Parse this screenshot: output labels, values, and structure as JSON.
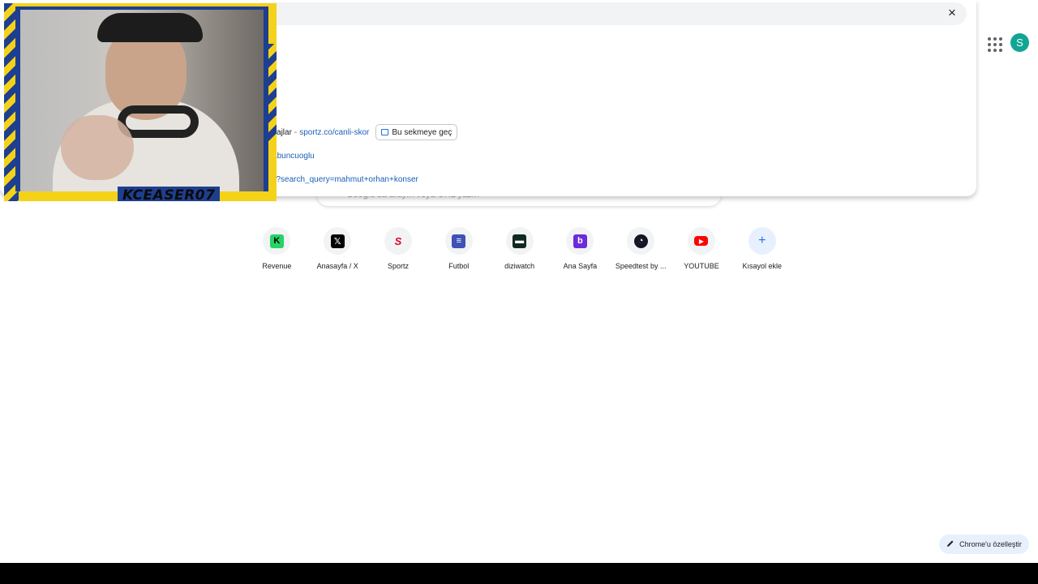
{
  "header": {
    "avatar_letter": "S",
    "apps_icon": "apps-grid-icon"
  },
  "omnibox": {
    "close_label": "×",
    "suggestions": [
      {
        "title": "...lı Mesajlar",
        "sep": "-",
        "url": "sportz.co/canli-skor",
        "action": "Bu sekmeye geç"
      },
      {
        "title": "",
        "sep": "",
        "url": "...agosabuncuoglu"
      },
      {
        "title": "",
        "sep": "",
        "url": "...esults?search_query=mahmut+orhan+konser"
      }
    ]
  },
  "search": {
    "placeholder": "Google'da arayın veya URL yazın"
  },
  "webcam": {
    "channel_label": "KCEASER07"
  },
  "shortcuts": [
    {
      "label": "Revenue",
      "icon": "k-logo-icon",
      "color": "#25d366",
      "glyph": "K"
    },
    {
      "label": "Anasayfa / X",
      "icon": "x-logo-icon",
      "color": "#000000",
      "glyph": "𝕏"
    },
    {
      "label": "Sportz",
      "icon": "sportz-logo-icon",
      "color": "#e4002b",
      "glyph": "S"
    },
    {
      "label": "Futbol",
      "icon": "futbol-logo-icon",
      "color": "#3f51b5",
      "glyph": "≡"
    },
    {
      "label": "diziwatch",
      "icon": "diziwatch-logo-icon",
      "color": "#0f2a1f",
      "glyph": "▬"
    },
    {
      "label": "Ana Sayfa",
      "icon": "beinconnect-logo-icon",
      "color": "#6c2bd9",
      "glyph": "b"
    },
    {
      "label": "Speedtest by ...",
      "icon": "speedtest-logo-icon",
      "color": "#141526",
      "glyph": "◔"
    },
    {
      "label": "YOUTUBE",
      "icon": "youtube-logo-icon",
      "color": "#ff0000",
      "glyph": "▶"
    },
    {
      "label": "Kısayol ekle",
      "icon": "plus-icon",
      "color": "#e8eaed",
      "glyph": "+"
    }
  ],
  "customize": {
    "label": "Chrome'u özelleştir",
    "icon": "pencil-icon"
  }
}
